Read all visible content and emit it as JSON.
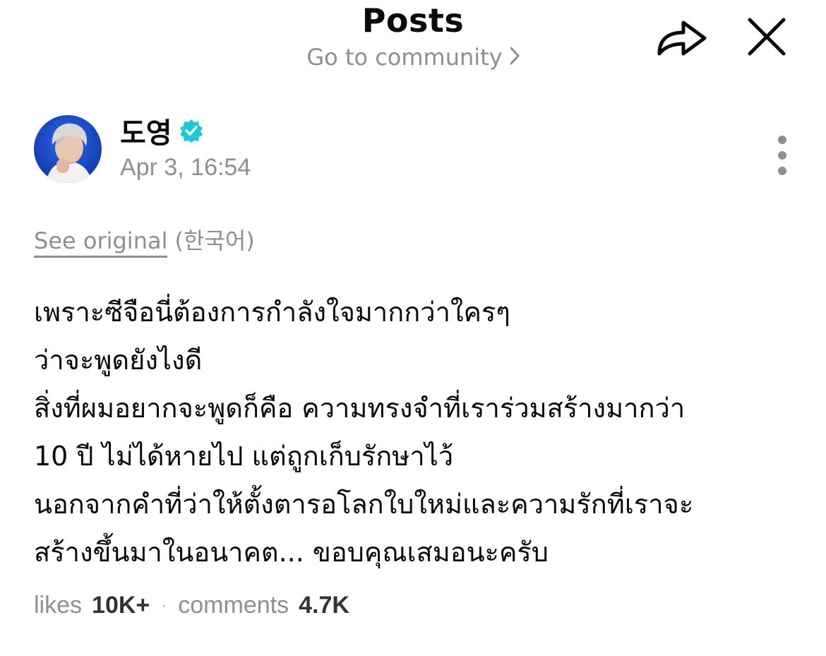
{
  "header": {
    "title": "Posts",
    "community_link": "Go to community",
    "share_icon": "share-icon",
    "close_icon": "close-icon"
  },
  "author": {
    "name": "도영",
    "verified_icon": "verified-badge-icon",
    "verified_color": "#1ec8d6",
    "timestamp": "Apr 3, 16:54"
  },
  "translation": {
    "see_original": "See original",
    "language": "(한국어)"
  },
  "post": {
    "lines": [
      "เพราะซีจือนี่ต้องการกำลังใจมากกว่าใครๆ",
      "ว่าจะพูดยังไงดี",
      "สิ่งที่ผมอยากจะพูดก็คือ ความทรงจำที่เราร่วมสร้างมากว่า",
      "10 ปี ไม่ได้หายไป แต่ถูกเก็บรักษาไว้",
      "นอกจากคำที่ว่าให้ตั้งตารอโลกใบใหม่และความรักที่เราจะ",
      "สร้างขึ้นมาในอนาคต... ขอบคุณเสมอนะครับ"
    ]
  },
  "stats": {
    "likes_label": "likes",
    "likes_count": "10K+",
    "separator": "·",
    "comments_label": "comments",
    "comments_count": "4.7K"
  }
}
